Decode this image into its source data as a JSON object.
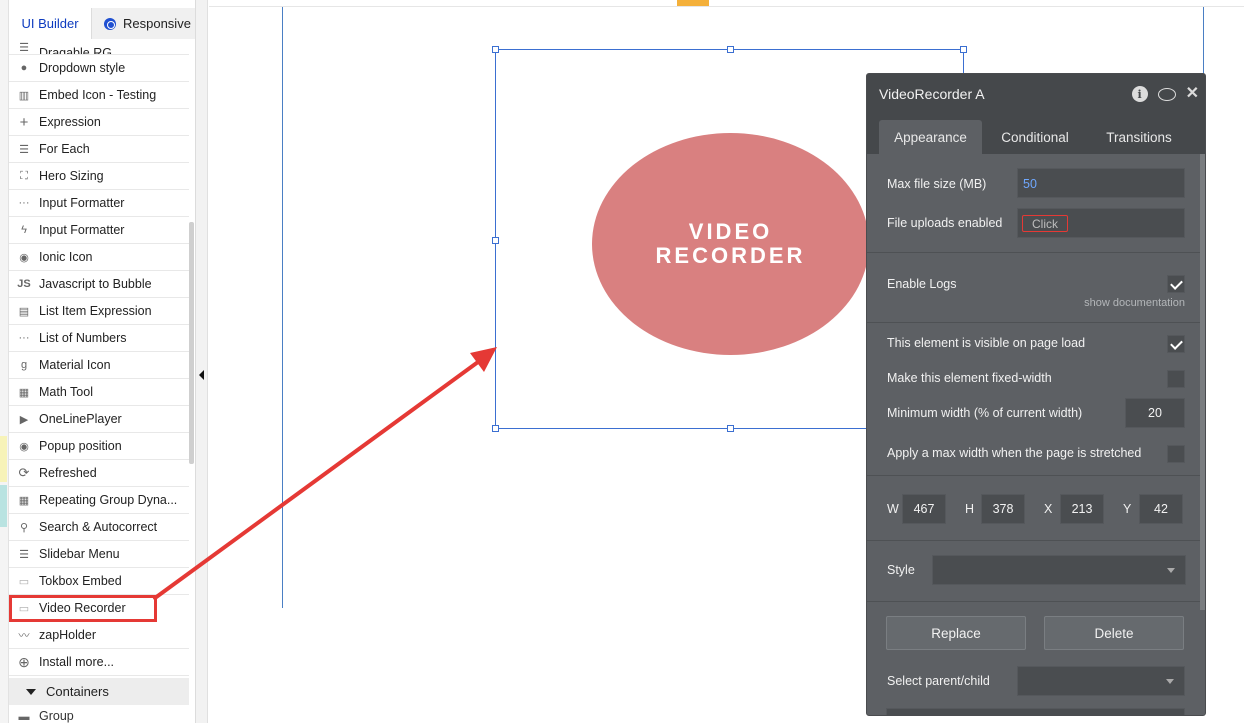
{
  "left_panel": {
    "tabs": {
      "ui_builder": "UI Builder",
      "responsive": "Responsive"
    },
    "partial_top_item": "Dragable RG",
    "items": [
      {
        "label": "Dropdown style",
        "icon": "dropdown-icon"
      },
      {
        "label": "Embed Icon - Testing",
        "icon": "barcode-icon"
      },
      {
        "label": "Expression",
        "icon": "plus-icon"
      },
      {
        "label": "For Each",
        "icon": "lines-icon"
      },
      {
        "label": "Hero Sizing",
        "icon": "expand-icon"
      },
      {
        "label": "Input Formatter",
        "icon": "dots-icon"
      },
      {
        "label": "Input Formatter",
        "icon": "lightning-icon"
      },
      {
        "label": "Ionic Icon",
        "icon": "target-icon"
      },
      {
        "label": "Javascript to Bubble",
        "icon": "js-icon"
      },
      {
        "label": "List Item Expression",
        "icon": "document-icon"
      },
      {
        "label": "List of Numbers",
        "icon": "dots-icon"
      },
      {
        "label": "Material Icon",
        "icon": "g-icon"
      },
      {
        "label": "Math Tool",
        "icon": "calculator-icon"
      },
      {
        "label": "OneLinePlayer",
        "icon": "play-icon"
      },
      {
        "label": "Popup position",
        "icon": "radio-icon"
      },
      {
        "label": "Refreshed",
        "icon": "refresh-icon"
      },
      {
        "label": "Repeating Group Dyna...",
        "icon": "grid-icon"
      },
      {
        "label": "Search & Autocorrect",
        "icon": "search-icon"
      },
      {
        "label": "Slidebar Menu",
        "icon": "lines-icon"
      },
      {
        "label": "Tokbox Embed",
        "icon": "camera-icon"
      },
      {
        "label": "Video Recorder",
        "icon": "camera-icon"
      },
      {
        "label": "zapHolder",
        "icon": "chart-icon"
      },
      {
        "label": "Install more...",
        "icon": "add-circle-icon"
      }
    ],
    "containers_header": "Containers",
    "group_item": "Group"
  },
  "canvas": {
    "element_text_line1": "VIDEO",
    "element_text_line2": "RECORDER",
    "oval_color": "#d98080"
  },
  "editor": {
    "title": "VideoRecorder A",
    "tabs": [
      "Appearance",
      "Conditional",
      "Transitions"
    ],
    "max_file_size_label": "Max file size (MB)",
    "max_file_size_value": "50",
    "file_uploads_label": "File uploads enabled",
    "file_uploads_value": "Click",
    "enable_logs_label": "Enable Logs",
    "show_documentation": "show documentation",
    "visible_on_load_label": "This element is visible on page load",
    "fixed_width_label": "Make this element fixed-width",
    "min_width_label": "Minimum width (% of current width)",
    "min_width_value": "20",
    "max_width_label": "Apply a max width when the page is stretched",
    "w_label": "W",
    "w_value": "467",
    "h_label": "H",
    "h_value": "378",
    "x_label": "X",
    "x_value": "213",
    "y_label": "Y",
    "y_value": "42",
    "style_label": "Style",
    "replace_label": "Replace",
    "delete_label": "Delete",
    "parent_child_label": "Select parent/child"
  },
  "colors": {
    "accent_blue": "#0d3bbf",
    "highlight_red": "#e53935",
    "top_accent": "#f4b03a"
  }
}
